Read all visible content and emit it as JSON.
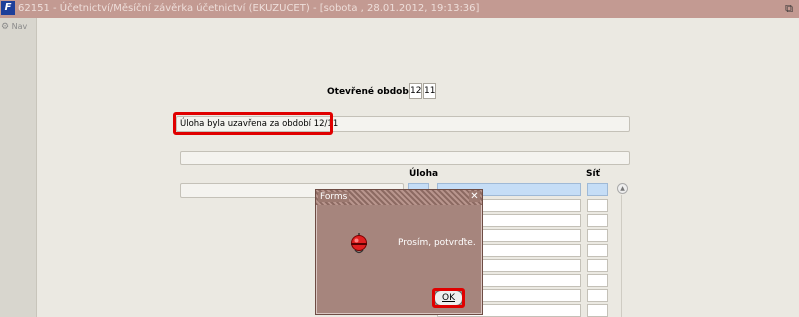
{
  "window": {
    "title": "62151 - Účetnictví/Měsíční závěrka účetnictví (EKUZUCET) - [sobota , 28.01.2012, 19:13:36]",
    "app_icon": "F"
  },
  "toolbar": {
    "nav_label": "Nav"
  },
  "form": {
    "period_label": "Otevřené období",
    "period_month": "12",
    "period_year": "11",
    "message": "Úloha byla uzavřena za období 12/11",
    "col_task": "Úloha",
    "col_net": "Síť"
  },
  "dialog": {
    "title": "Forms",
    "message": "Prosím, potvrďte.",
    "ok_label": "OK",
    "icon": "alarm-bell-icon"
  },
  "colors": {
    "titlebar": "#c39a92",
    "dialog": "#a6857d",
    "highlight": "#e00000",
    "selected_cell": "#c5ddf6"
  }
}
